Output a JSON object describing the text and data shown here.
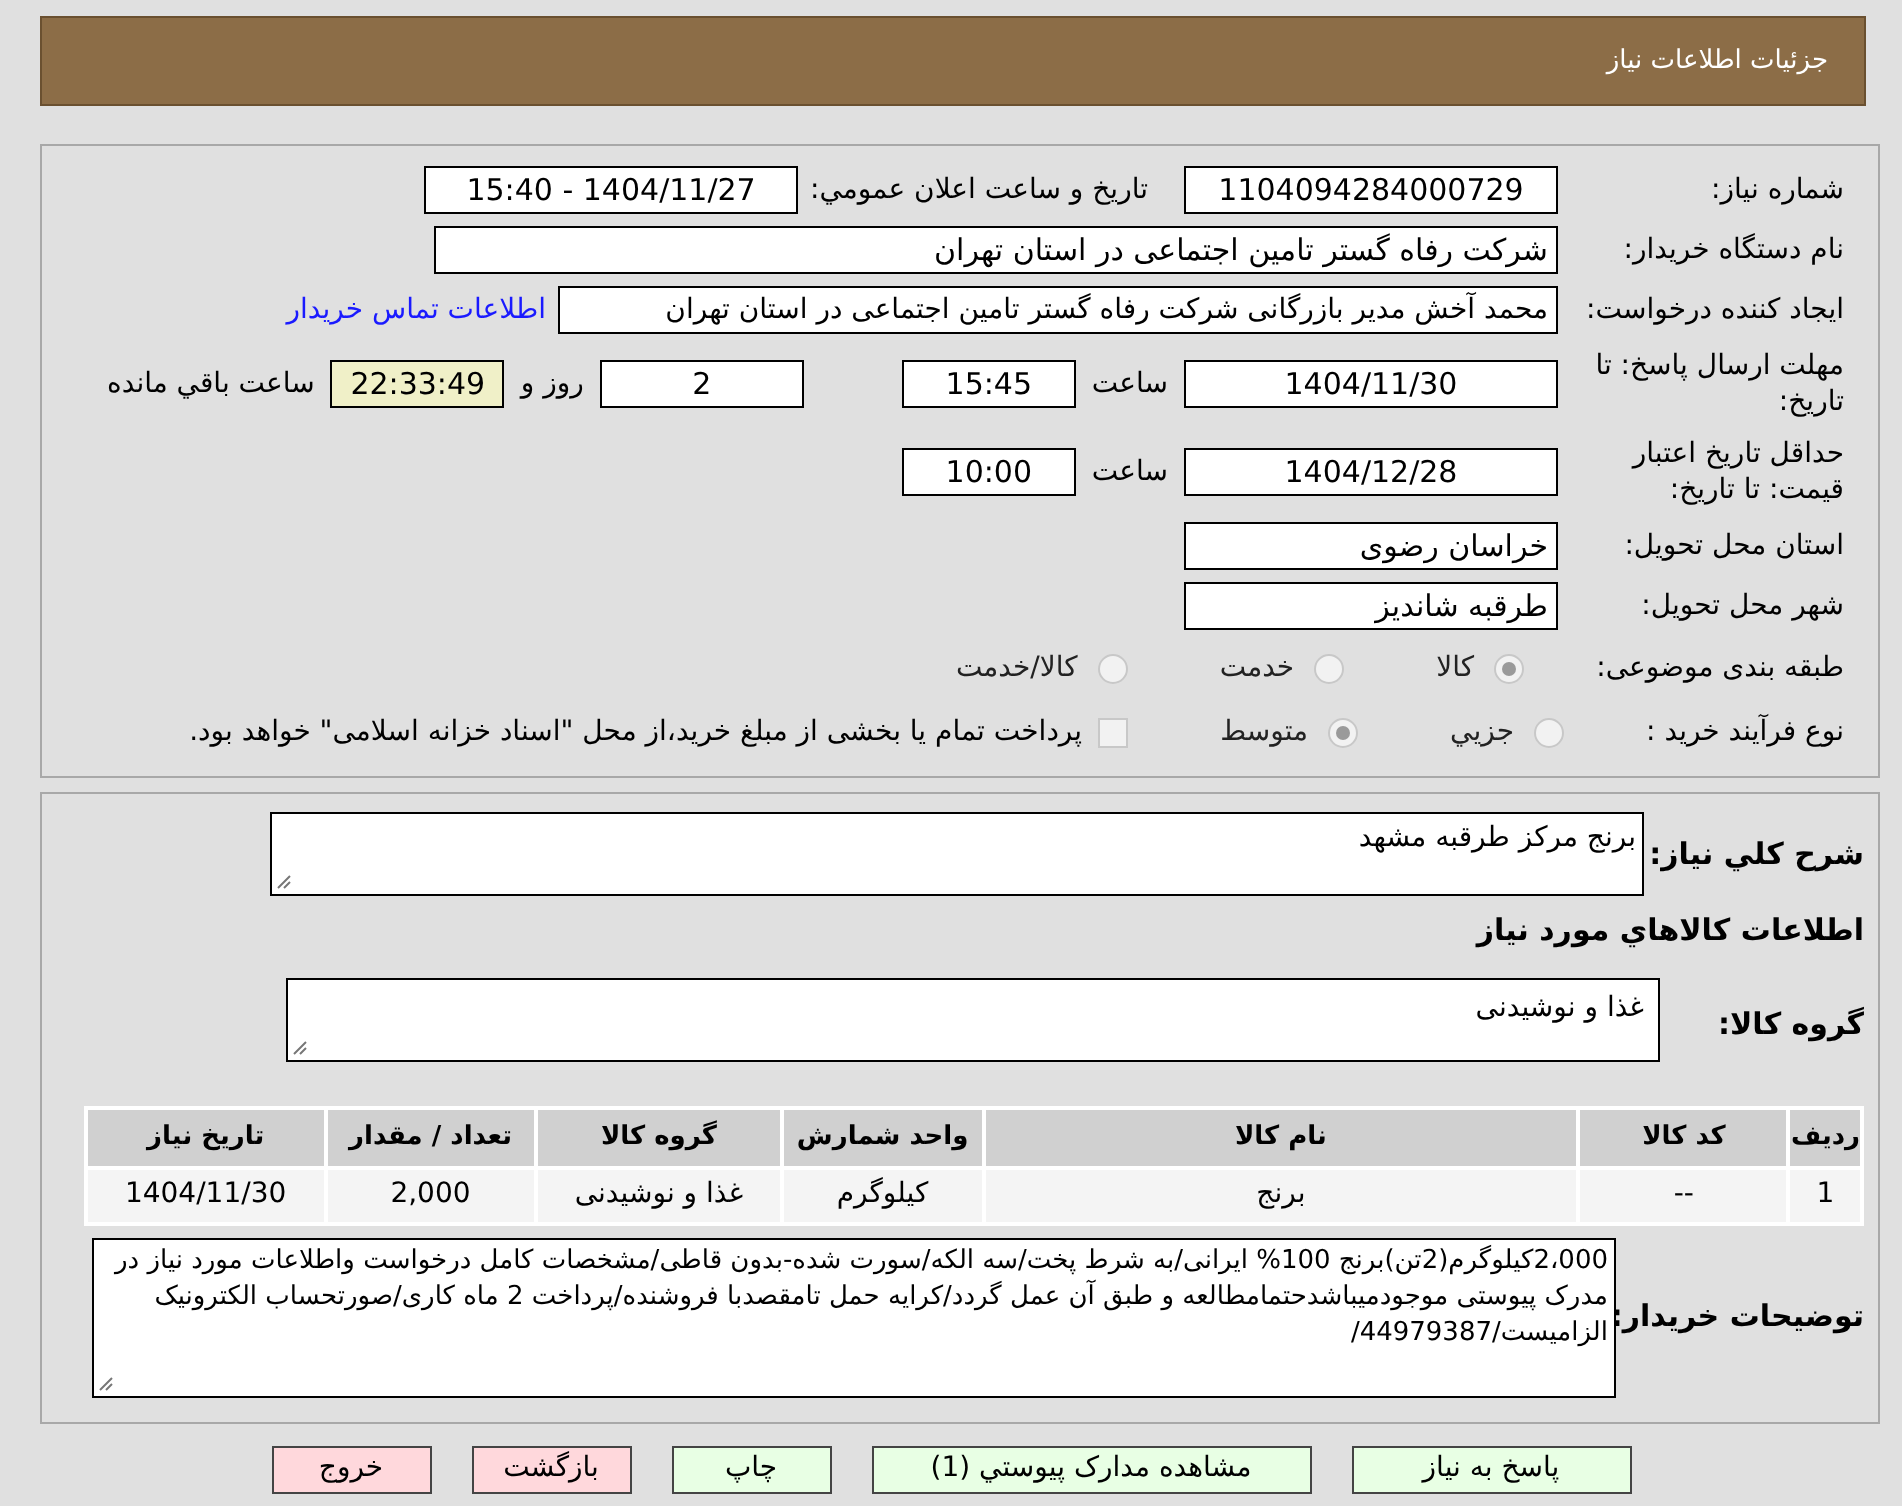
{
  "header": {
    "title": "جزئیات اطلاعات نیاز"
  },
  "details": {
    "need_number": {
      "label": "شماره نیاز:",
      "value": "1104094284000729"
    },
    "announce": {
      "label": "تاريخ و ساعت اعلان عمومي:",
      "value": "1404/11/27 - 15:40"
    },
    "buyer": {
      "label": "نام دستگاه خریدار:",
      "value": "شرکت رفاه گستر تامین اجتماعی در استان تهران"
    },
    "creator": {
      "label": "ایجاد کننده درخواست:",
      "value": "محمد آخش مدیر بازرگانی شرکت رفاه گستر تامین اجتماعی در استان تهران",
      "link": "اطلاعات تماس خریدار"
    },
    "deadline": {
      "label": "مهلت ارسال پاسخ: تا تاریخ:",
      "date": "1404/11/30",
      "time_label": "ساعت",
      "time": "15:45",
      "days": "2",
      "days_label": "روز و",
      "remaining": "22:33:49",
      "remaining_label": "ساعت باقي مانده"
    },
    "validity": {
      "label": "حداقل تاریخ اعتبار قیمت: تا تاریخ:",
      "date": "1404/12/28",
      "time_label": "ساعت",
      "time": "10:00"
    },
    "province": {
      "label": "استان محل تحویل:",
      "value": "خراسان رضوی"
    },
    "city": {
      "label": "شهر محل تحویل:",
      "value": "طرقبه شاندیز"
    },
    "category": {
      "label": "طبقه بندی موضوعی:",
      "options": [
        {
          "label": "کالا",
          "selected": true
        },
        {
          "label": "خدمت",
          "selected": false
        },
        {
          "label": "کالا/خدمت",
          "selected": false
        }
      ]
    },
    "process": {
      "label": "نوع فرآیند خرید :",
      "options": [
        {
          "label": "جزيي",
          "selected": false
        },
        {
          "label": "متوسط",
          "selected": true
        }
      ],
      "treasury": {
        "checked": false,
        "label": "پرداخت تمام یا بخشی از مبلغ خرید،از محل \"اسناد خزانه اسلامی\" خواهد بود."
      }
    }
  },
  "goods": {
    "description": {
      "label": "شرح کلي نياز:",
      "value": "برنج مرکز طرقبه مشهد"
    },
    "heading": "اطلاعات کالاهاي مورد نياز",
    "group": {
      "label": "گروه کالا:",
      "value": "غذا و نوشیدنی"
    },
    "table": {
      "columns": [
        "ردیف",
        "کد کالا",
        "نام کالا",
        "واحد شمارش",
        "گروه کالا",
        "تعداد / مقدار",
        "تاریخ نیاز"
      ],
      "rows": [
        [
          "1",
          "--",
          "برنج",
          "کیلوگرم",
          "غذا و نوشیدنی",
          "2,000",
          "1404/11/30"
        ]
      ]
    },
    "notes": {
      "label": "توضیحات خریدار:",
      "value": "2،000کیلوگرم(2تن)برنج 100% ایرانی/به شرط پخت/سه الکه/سورت شده-بدون قاطی/مشخصات کامل درخواست واطلاعات مورد نیاز در مدرک پیوستی موجودمیباشدحتمامطالعه و طبق آن عمل گردد/کرایه حمل تامقصدبا فروشنده/پرداخت 2 ماه کاری/صورتحساب الکترونیک الزامیست/44979387/"
    }
  },
  "buttons": [
    {
      "label": "پاسخ به نیاز",
      "kind": "primary"
    },
    {
      "label": "مشاهده مدارک پیوستي (1)",
      "kind": "primary"
    },
    {
      "label": "چاپ",
      "kind": "primary"
    },
    {
      "label": "بازگشت",
      "kind": "danger"
    },
    {
      "label": "خروج",
      "kind": "danger"
    }
  ]
}
